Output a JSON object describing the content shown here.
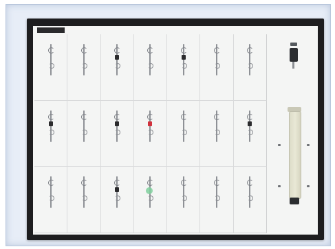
{
  "image": {
    "content_colors": {
      "mat": "#e7edf7",
      "board_frame": "#1d1d1f",
      "panel": "#f4f5f4"
    },
    "samples": [
      {
        "accent": "none"
      },
      {
        "accent": "none"
      },
      {
        "accent": "dark"
      },
      {
        "accent": "none"
      },
      {
        "accent": "dark"
      },
      {
        "accent": "none"
      },
      {
        "accent": "none"
      },
      {
        "accent": "dark"
      },
      {
        "accent": "none"
      },
      {
        "accent": "dark"
      },
      {
        "accent": "red"
      },
      {
        "accent": "none"
      },
      {
        "accent": "none"
      },
      {
        "accent": "dark"
      },
      {
        "accent": "none"
      },
      {
        "accent": "none"
      },
      {
        "accent": "dark"
      },
      {
        "accent": "green"
      },
      {
        "accent": "none"
      },
      {
        "accent": "none"
      },
      {
        "accent": "none"
      }
    ]
  }
}
